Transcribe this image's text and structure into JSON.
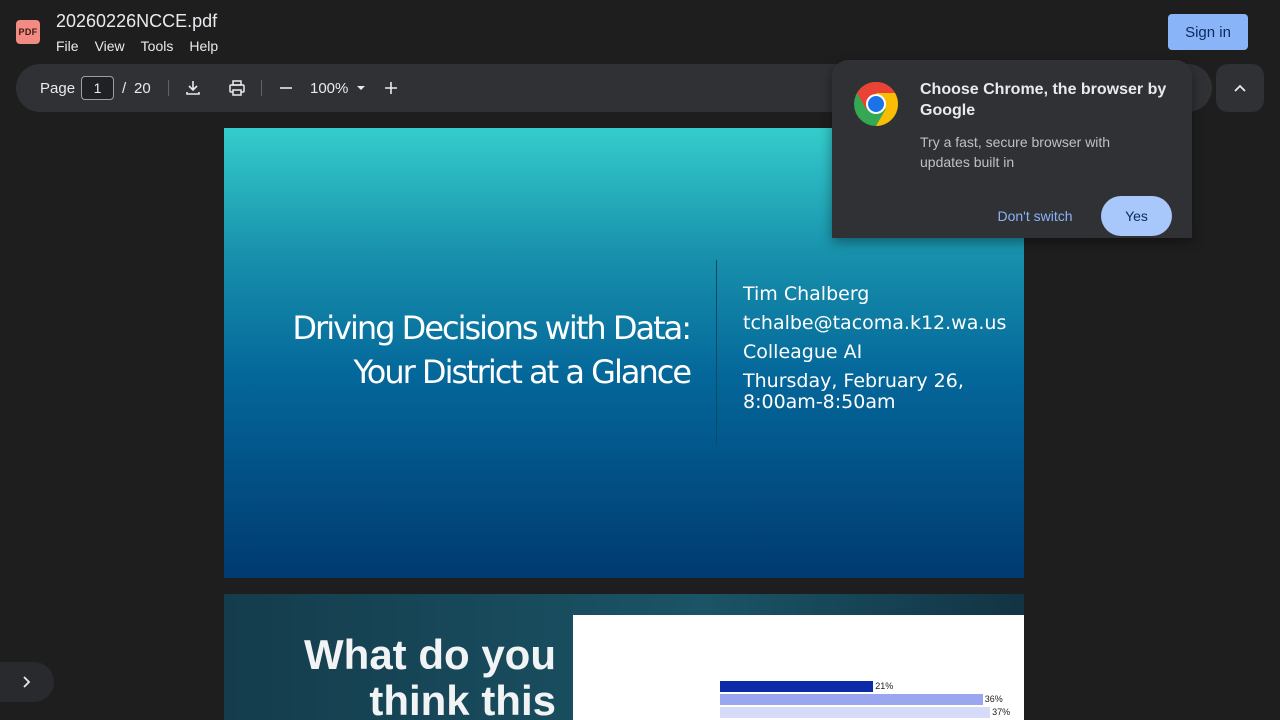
{
  "app": {
    "icon_label": "PDF",
    "title": "20260226NCCE.pdf"
  },
  "menu": [
    "File",
    "View",
    "Tools",
    "Help"
  ],
  "header": {
    "sign_in_label": "Sign in"
  },
  "toolbar": {
    "page_label": "Page",
    "current_page": "1",
    "separator": "/",
    "total_pages": "20",
    "zoom": "100%"
  },
  "popup": {
    "title": "Choose Chrome, the browser by Google",
    "body": "Try a fast, secure browser with updates built in",
    "dont_switch_label": "Don't switch",
    "yes_label": "Yes"
  },
  "slide1": {
    "title_line1": "Driving Decisions with Data:",
    "title_line2": "Your District at a Glance",
    "presenter": "Tim Chalberg",
    "email": "tchalbe@tacoma.k12.wa.us",
    "org": "Colleague AI",
    "date": "Thursday, February 26, 8:00am-8:50am"
  },
  "slide2": {
    "title_line1": "What do you",
    "title_line2": "think this",
    "bars": [
      {
        "label": "21%",
        "value": 21,
        "color": "#0d2aa8"
      },
      {
        "label": "36%",
        "value": 36,
        "color": "#9aa6f0"
      },
      {
        "label": "37%",
        "value": 37,
        "color": "#d6dbfa"
      }
    ]
  },
  "colors": {
    "accent": "#8ab4f8",
    "popup_yes": "#a8c7fa",
    "pdf_icon": "#f28b82"
  }
}
